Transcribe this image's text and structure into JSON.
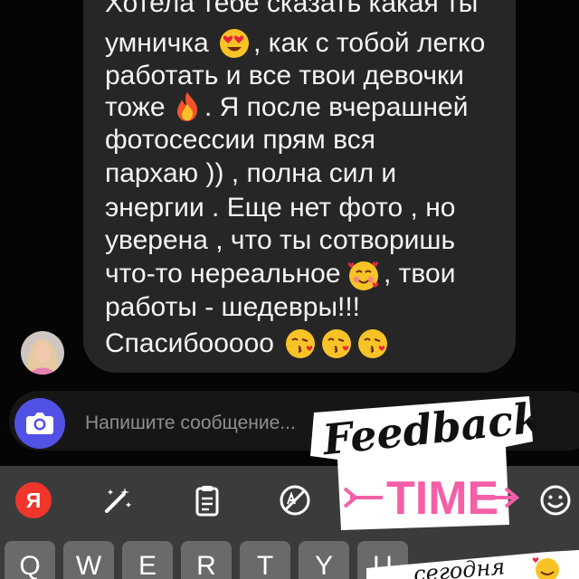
{
  "message": {
    "lines": [
      "Хотела тебе сказать какая ты",
      "умничка",
      ", как с тобой легко",
      "работать и все твои девочки",
      "тоже",
      ". Я после вчерашней",
      "фотосессии прям вся",
      "пархаю )) , полна сил и",
      "энергии . Еще нет фото , но",
      "уверена , что  ты сотворишь",
      "что-то нереальное",
      ", твои",
      "работы - шедевры!!!",
      "Спасибооооо"
    ],
    "emojis": [
      "heart-eyes-emoji",
      "fire-emoji",
      "smiling-hearts-emoji",
      "kiss-emoji",
      "kiss-emoji",
      "kiss-emoji"
    ]
  },
  "composer": {
    "placeholder": "Напишите сообщение..."
  },
  "keyboard": {
    "toolbar": [
      "yandex-icon",
      "magic-wand-icon",
      "clipboard-icon",
      "translate-icon",
      "emoji-icon"
    ],
    "yandex_label": "Я",
    "keys": [
      "Q",
      "W",
      "E",
      "R",
      "T",
      "Y",
      "U"
    ]
  },
  "stickers": {
    "feedback_word": "Feedback",
    "time_word": "TIME",
    "today_text": "сегодня"
  },
  "colors": {
    "bubble": "#262626",
    "camera_button": "#5251e6",
    "sticker_pink": "#f45fa8",
    "yandex_red": "#f0352a"
  }
}
